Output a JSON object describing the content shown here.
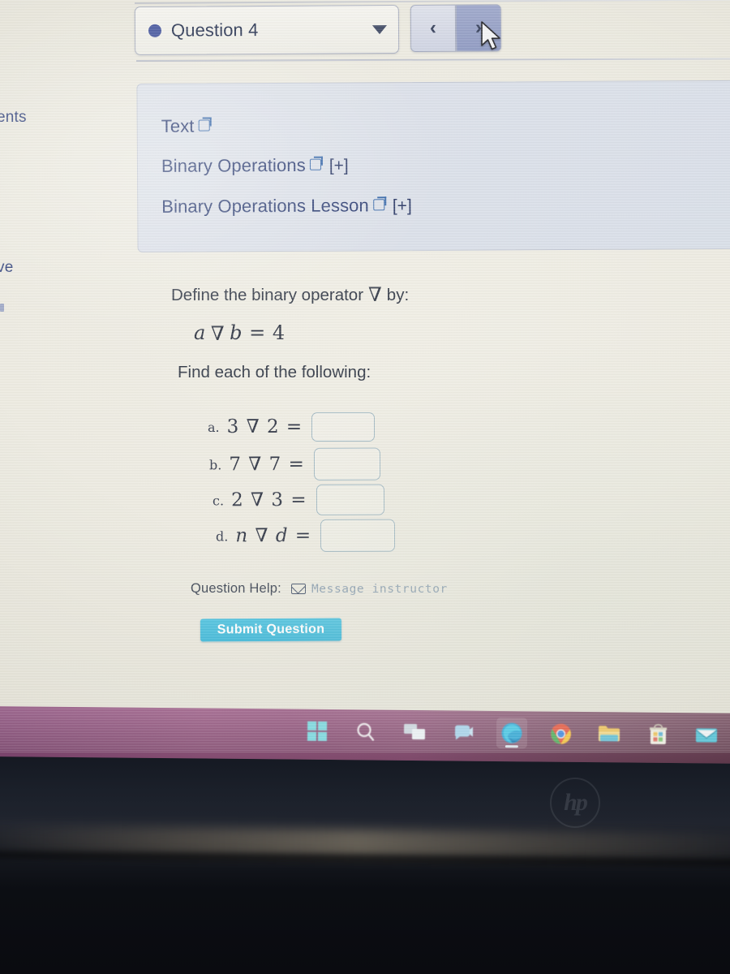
{
  "sidebar": {
    "clipped_items": [
      {
        "label": "ents"
      },
      {
        "label": "ve"
      }
    ]
  },
  "toolbar": {
    "question_selector": {
      "label": "Question 4",
      "bullet_color": "#3e4f9b",
      "caret": "chevron-down-icon"
    },
    "prev_label": "‹",
    "next_label": "›"
  },
  "resources": {
    "items": [
      {
        "label": "Text",
        "has_external_link": true,
        "expand": ""
      },
      {
        "label": "Binary Operations",
        "has_external_link": true,
        "expand": "[+]"
      },
      {
        "label": "Binary Operations Lesson",
        "has_external_link": true,
        "expand": "[+]"
      }
    ]
  },
  "question": {
    "prompt_prefix": "Define the binary operator",
    "operator_symbol": "∇",
    "prompt_suffix": "by:",
    "definition": "a ∇ b = 4",
    "definition_lhs_a": "a",
    "definition_lhs_b": "b",
    "definition_rhs": "4",
    "find_label": "Find each of the following:",
    "parts": [
      {
        "letter": "a.",
        "expression": "3 ∇ 2 =",
        "answer": ""
      },
      {
        "letter": "b.",
        "expression": "7 ∇ 7 =",
        "answer": ""
      },
      {
        "letter": "c.",
        "expression": "2 ∇ 3 =",
        "answer": ""
      },
      {
        "letter": "d.",
        "expression": "n ∇ d =",
        "answer": ""
      }
    ],
    "answer_placeholder": ""
  },
  "help": {
    "label": "Question Help:",
    "message_instructor": "Message instructor",
    "mail_icon": "envelope-icon"
  },
  "actions": {
    "submit_label": "Submit Question",
    "submit_color": "#45bdda"
  },
  "taskbar": {
    "background_color": "#96587f",
    "items": [
      {
        "name": "start-icon",
        "label": "Start"
      },
      {
        "name": "search-icon",
        "label": "Search"
      },
      {
        "name": "task-view-icon",
        "label": "Task View"
      },
      {
        "name": "chat-icon",
        "label": "Chat"
      },
      {
        "name": "edge-icon",
        "label": "Microsoft Edge",
        "active": true
      },
      {
        "name": "chrome-icon",
        "label": "Google Chrome"
      },
      {
        "name": "file-explorer-icon",
        "label": "File Explorer"
      },
      {
        "name": "microsoft-store-icon",
        "label": "Microsoft Store"
      },
      {
        "name": "mail-icon",
        "label": "Mail"
      }
    ]
  },
  "device": {
    "brand_logo": "hp"
  }
}
